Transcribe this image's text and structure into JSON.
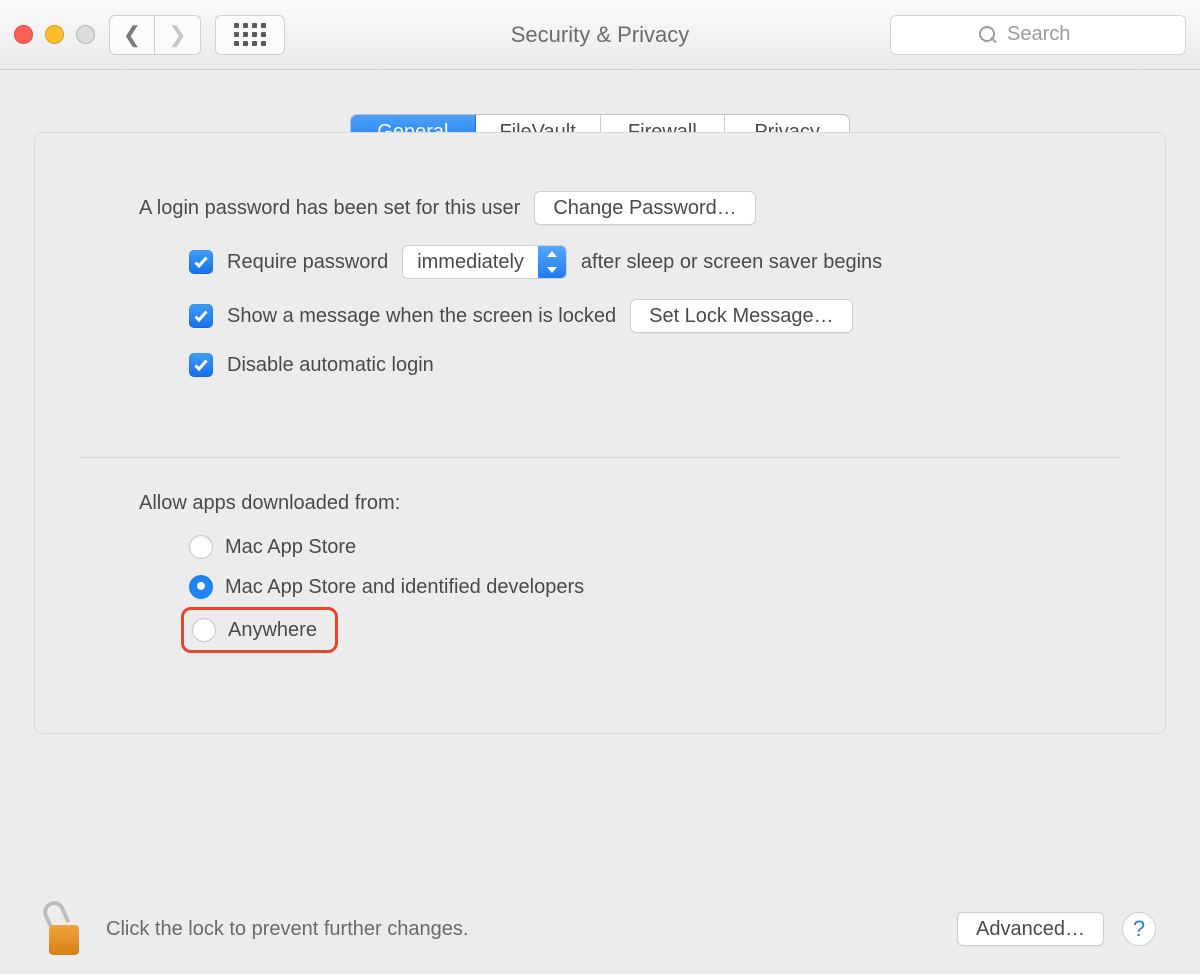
{
  "window": {
    "title": "Security & Privacy"
  },
  "toolbar": {
    "search_placeholder": "Search"
  },
  "tabs": {
    "items": [
      "General",
      "FileVault",
      "Firewall",
      "Privacy"
    ],
    "selected": 0
  },
  "general": {
    "login_pw_text": "A login password has been set for this user",
    "change_pw_btn": "Change Password…",
    "require_pw_label_before": "Require password",
    "require_pw_value": "immediately",
    "require_pw_label_after": "after sleep or screen saver begins",
    "show_msg_label": "Show a message when the screen is locked",
    "set_lock_msg_btn": "Set Lock Message…",
    "disable_autologin_label": "Disable automatic login",
    "allow_apps_heading": "Allow apps downloaded from:",
    "radios": {
      "mas": "Mac App Store",
      "mas_identified": "Mac App Store and identified developers",
      "anywhere": "Anywhere"
    },
    "selected_radio": "mas_identified"
  },
  "footer": {
    "lock_text": "Click the lock to prevent further changes.",
    "advanced_btn": "Advanced…",
    "help": "?"
  }
}
